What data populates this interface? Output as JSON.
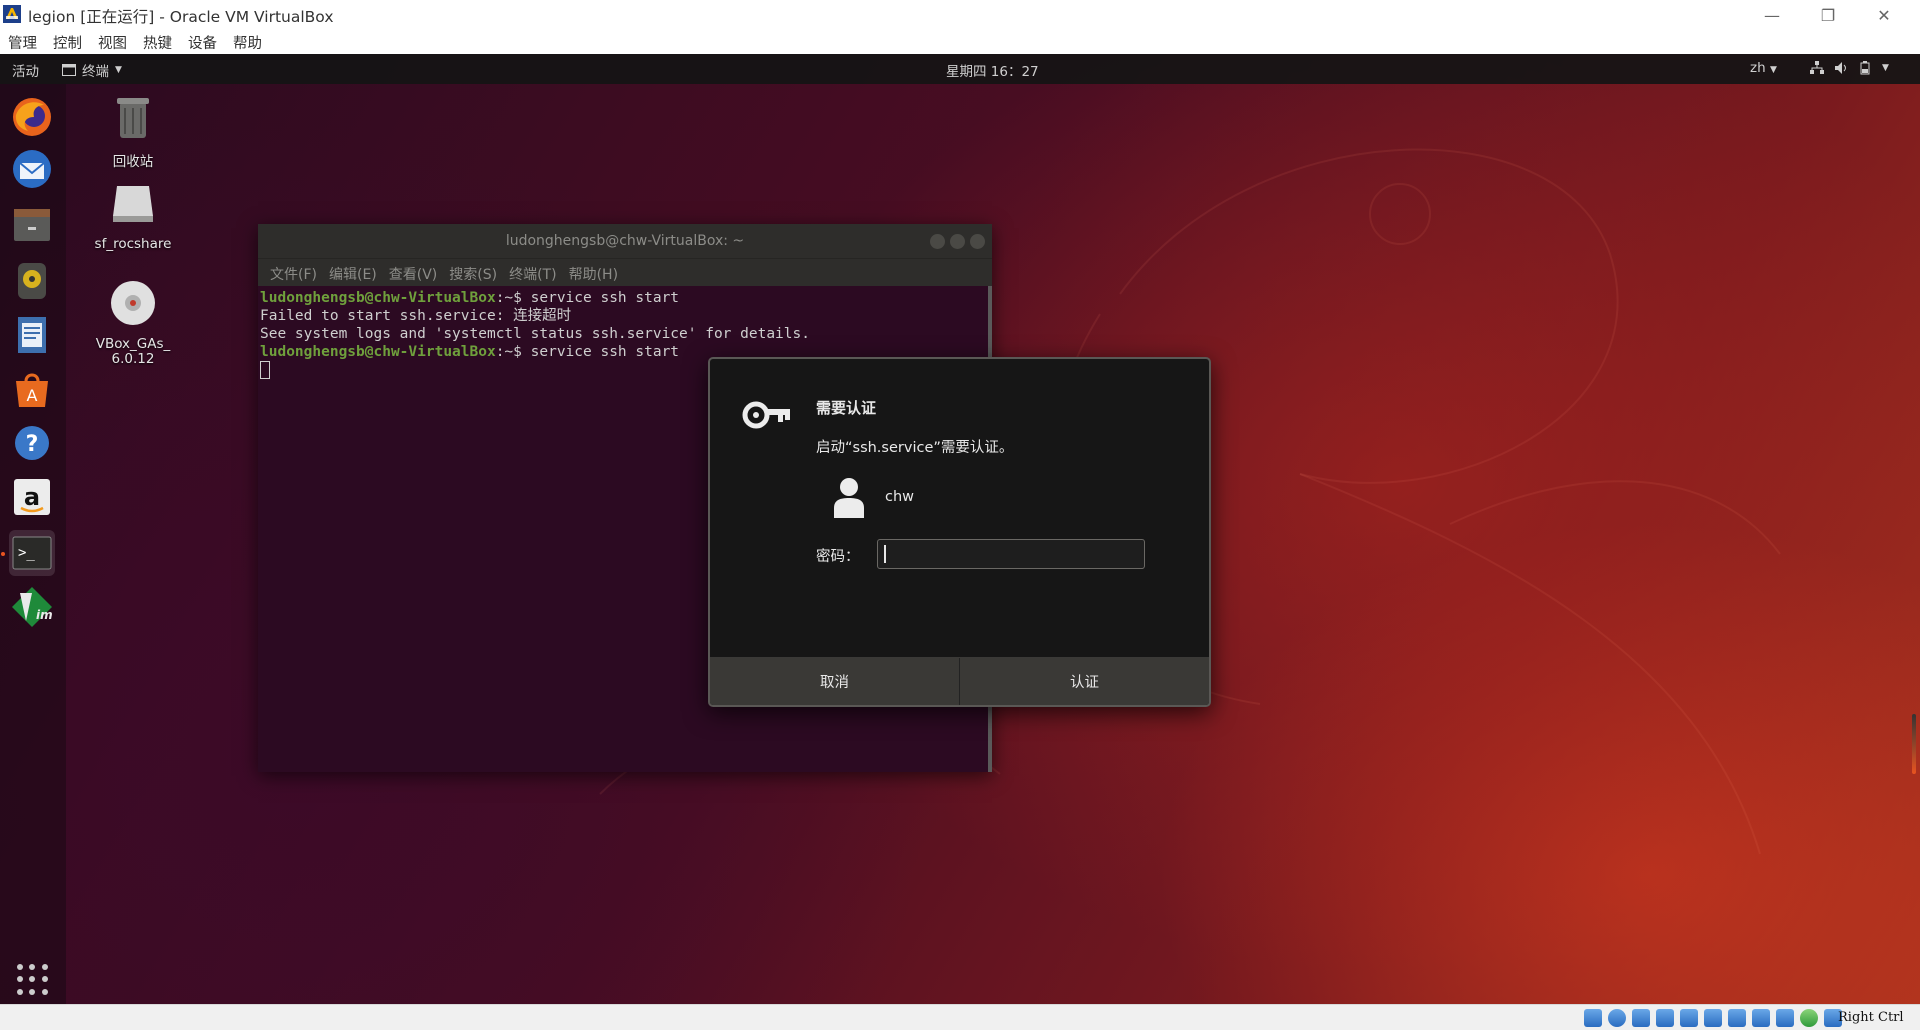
{
  "host_window": {
    "title": "legion [正在运行] - Oracle VM VirtualBox",
    "controls": {
      "minimize": "—",
      "restore": "❐",
      "close": "✕"
    },
    "menu": [
      "管理",
      "控制",
      "视图",
      "热键",
      "设备",
      "帮助"
    ]
  },
  "gnome_topbar": {
    "activities": "活动",
    "app_menu": "终端",
    "clock": "星期四 16：27",
    "input_method": "zh"
  },
  "dock": {
    "items": [
      "firefox-icon",
      "thunderbird-icon",
      "files-icon",
      "rhythmbox-icon",
      "writer-icon",
      "software-icon",
      "help-icon",
      "amazon-icon",
      "terminal-icon",
      "vim-icon"
    ]
  },
  "desktop": {
    "icons": [
      {
        "label": "回收站"
      },
      {
        "label": "sf_rocshare"
      },
      {
        "label": "VBox_GAs_\n6.0.12"
      }
    ]
  },
  "terminal": {
    "title": "ludonghengsb@chw-VirtualBox: ~",
    "menu": [
      "文件(F)",
      "编辑(E)",
      "查看(V)",
      "搜索(S)",
      "终端(T)",
      "帮助(H)"
    ],
    "lines": [
      {
        "prompt": "ludonghengsb@chw-VirtualBox",
        "suffix": ":~$ ",
        "text": "service ssh start"
      },
      {
        "prompt": "",
        "suffix": "",
        "text": "Failed to start ssh.service: 连接超时"
      },
      {
        "prompt": "",
        "suffix": "",
        "text": "See system logs and 'systemctl status ssh.service' for details."
      },
      {
        "prompt": "ludonghengsb@chw-VirtualBox",
        "suffix": ":~$ ",
        "text": "service ssh start"
      }
    ]
  },
  "auth_dialog": {
    "title": "需要认证",
    "message": "启动“ssh.service”需要认证。",
    "user": "chw",
    "password_label": "密码：",
    "password_value": "",
    "cancel_label": "取消",
    "confirm_label": "认证"
  },
  "status_bar": {
    "host_key": "Right Ctrl"
  },
  "colors": {
    "ubuntu_orange": "#e95420",
    "prompt_green": "#6fa03c",
    "terminal_bg": "#2c0a22"
  }
}
